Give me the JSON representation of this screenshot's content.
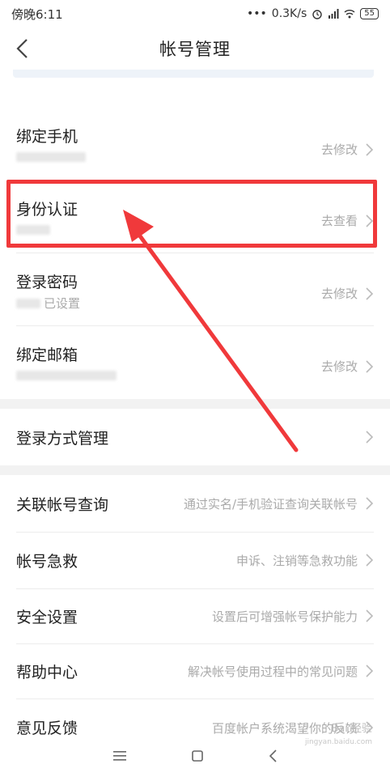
{
  "status_bar": {
    "time": "傍晚6:11",
    "dots": "•••",
    "speed": "0.3K/s",
    "battery": "55"
  },
  "header": {
    "title": "帐号管理"
  },
  "account_rows": [
    {
      "label": "绑定手机",
      "action": "去修改",
      "sub": ""
    },
    {
      "label": "身份认证",
      "action": "去查看",
      "sub": ""
    },
    {
      "label": "登录密码",
      "action": "去修改",
      "sub": "已设置"
    },
    {
      "label": "绑定邮箱",
      "action": "去修改",
      "sub": ""
    }
  ],
  "login_method": {
    "label": "登录方式管理"
  },
  "list_rows": [
    {
      "label": "关联帐号查询",
      "hint": "通过实名/手机验证查询关联帐号"
    },
    {
      "label": "帐号急救",
      "hint": "申诉、注销等急救功能"
    },
    {
      "label": "安全设置",
      "hint": "设置后可增强帐号保护能力"
    },
    {
      "label": "帮助中心",
      "hint": "解决帐号使用过程中的常见问题"
    },
    {
      "label": "意见反馈",
      "hint": "百度帐户系统渴望你的反馈"
    }
  ],
  "watermark": {
    "brand": "Bai 经验",
    "site": "jingyan.baidu.com"
  },
  "colors": {
    "highlight": "#f0393b",
    "text": "#222222",
    "muted": "#aaaaaa",
    "section_gap": "#f2f2f2"
  },
  "icons": [
    "back-arrow",
    "alarm",
    "signal",
    "wifi",
    "battery",
    "chevron-right",
    "menu",
    "home",
    "back"
  ]
}
